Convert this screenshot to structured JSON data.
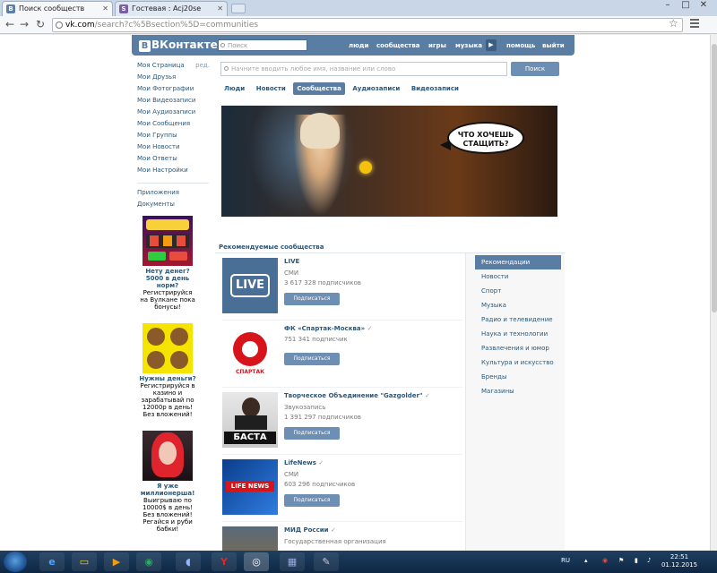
{
  "browser": {
    "tabs": [
      {
        "title": "Поиск сообществ",
        "favicon": "В",
        "active": true
      },
      {
        "title": "Гостевая : Acj20se",
        "favicon": "S",
        "active": false
      }
    ],
    "url_host": "vk.com",
    "url_path": "/search?c%5Bsection%5D=communities"
  },
  "vk": {
    "logo": "ВКонтакте",
    "logo_letter": "В",
    "search_placeholder": "Поиск",
    "nav": [
      "люди",
      "сообщества",
      "игры",
      "музыка",
      "помощь",
      "выйти"
    ]
  },
  "leftnav": {
    "items": [
      "Моя Страница",
      "Мои Друзья",
      "Мои Фотографии",
      "Мои Видеозаписи",
      "Мои Аудиозаписи",
      "Мои Сообщения",
      "Мои Группы",
      "Мои Новости",
      "Мои Ответы",
      "Мои Настройки"
    ],
    "edit_label": "ред.",
    "extra": [
      "Приложения",
      "Документы"
    ]
  },
  "ads": [
    {
      "title": "Нету денег? 5000 в день норм?",
      "text": "Регистрируйся на Вулкане пока бонусы!"
    },
    {
      "title": "Нужны деньги?",
      "text": "Регистрируйся в казино и зарабатывай по 12000р в день! Без вложений!"
    },
    {
      "title": "Я уже миллионерша!",
      "text": "Выигрываю по 10000$ в день! Без вложений! Регайся и руби бабки!"
    }
  ],
  "search": {
    "placeholder": "Начните вводить любое имя, название или слово",
    "button": "Поиск",
    "tabs": [
      "Люди",
      "Новости",
      "Сообщества",
      "Аудиозаписи",
      "Видеозаписи"
    ],
    "active_tab": "Сообщества"
  },
  "banner": {
    "text_line1": "ЧТО ХОЧЕШЬ",
    "text_line2": "СТАЩИТЬ?"
  },
  "recommended_title": "Рекомендуемые сообщества",
  "communities": [
    {
      "name": "LIVE",
      "verified": false,
      "category": "СМИ",
      "subscribers": "3 617 328 подписчиков",
      "button": "Подписаться",
      "thumb_text": "LIVE"
    },
    {
      "name": "ФК «Спартак-Москва»",
      "verified": true,
      "category": "",
      "subscribers": "751 341 подписчик",
      "button": "Подписаться",
      "thumb_text": "СПАРТАК"
    },
    {
      "name": "Творческое Объединение \"Gazgolder\"",
      "verified": true,
      "category": "Звукозапись",
      "subscribers": "1 391 297 подписчиков",
      "button": "Подписаться",
      "thumb_text": "БАСТА"
    },
    {
      "name": "LifeNews",
      "verified": true,
      "category": "СМИ",
      "subscribers": "603 296 подписчиков",
      "button": "Подписаться",
      "thumb_text": "LIFE NEWS"
    },
    {
      "name": "МИД России",
      "verified": true,
      "category": "Государственная организация",
      "subscribers": "",
      "button": "Подписаться",
      "thumb_text": ""
    }
  ],
  "categories": {
    "items": [
      "Рекомендации",
      "Новости",
      "Спорт",
      "Музыка",
      "Радио и телевидение",
      "Наука и технологии",
      "Развлечения и юмор",
      "Культура и искусство",
      "Бренды",
      "Магазины"
    ],
    "selected": "Рекомендации"
  },
  "taskbar": {
    "lang": "RU",
    "time": "22:51",
    "date": "01.12.2015"
  },
  "colors": {
    "vk_blue": "#597da3",
    "link": "#2b587a",
    "button": "#6d8fb3"
  }
}
